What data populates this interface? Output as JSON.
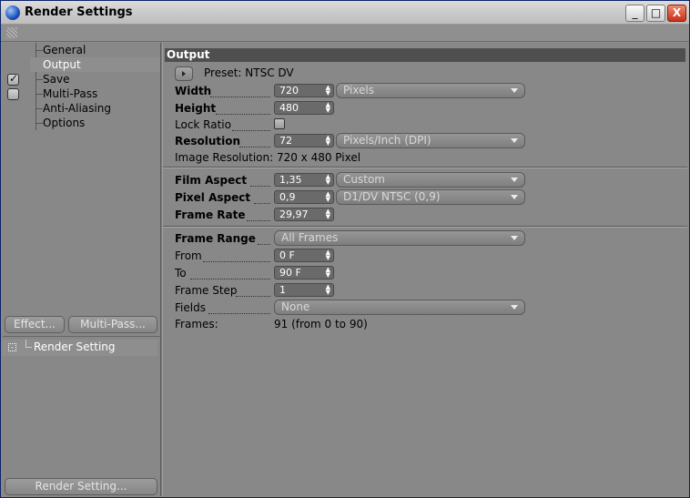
{
  "window": {
    "title": "Render Settings",
    "controls": {
      "minimize": "_",
      "maximize": "□",
      "close": "X"
    }
  },
  "sidebar": {
    "items": [
      {
        "label": "General",
        "checked": null,
        "selected": false
      },
      {
        "label": "Output",
        "checked": null,
        "selected": true
      },
      {
        "label": "Save",
        "checked": true,
        "selected": false
      },
      {
        "label": "Multi-Pass",
        "checked": false,
        "selected": false
      },
      {
        "label": "Anti-Aliasing",
        "checked": null,
        "selected": false
      },
      {
        "label": "Options",
        "checked": null,
        "selected": false
      }
    ],
    "effect_button": "Effect...",
    "multipass_button": "Multi-Pass...",
    "render_setting_item": "Render Setting",
    "render_setting_button": "Render Setting..."
  },
  "output": {
    "header": "Output",
    "preset": "Preset: NTSC DV",
    "width": {
      "label": "Width",
      "value": "720",
      "unit": "Pixels"
    },
    "height": {
      "label": "Height",
      "value": "480"
    },
    "lock_ratio": {
      "label": "Lock Ratio",
      "checked": false
    },
    "resolution": {
      "label": "Resolution",
      "value": "72",
      "unit": "Pixels/Inch (DPI)"
    },
    "image_resolution": "Image Resolution: 720 x 480 Pixel",
    "film_aspect": {
      "label": "Film Aspect",
      "value": "1,35",
      "option": "Custom"
    },
    "pixel_aspect": {
      "label": "Pixel Aspect",
      "value": "0,9",
      "option": "D1/DV NTSC (0,9)"
    },
    "frame_rate": {
      "label": "Frame Rate",
      "value": "29,97"
    },
    "frame_range": {
      "label": "Frame Range",
      "option": "All Frames"
    },
    "from": {
      "label": "From",
      "value": "0 F"
    },
    "to": {
      "label": "To",
      "value": "90 F"
    },
    "frame_step": {
      "label": "Frame Step",
      "value": "1"
    },
    "fields": {
      "label": "Fields",
      "option": "None"
    },
    "frames": {
      "label": "Frames:",
      "value": "91 (from 0 to 90)"
    }
  }
}
